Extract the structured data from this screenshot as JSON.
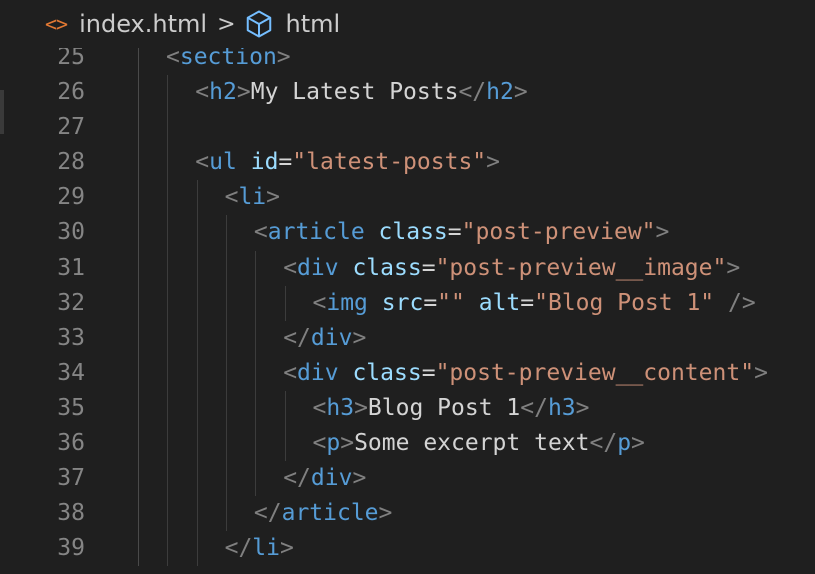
{
  "breadcrumb": {
    "file_icon": "<>",
    "file_name": "index.html",
    "separator": ">",
    "symbol_name": "html"
  },
  "colors": {
    "background": "#1f1f1f",
    "punctuation": "#808080",
    "tag": "#569cd6",
    "attribute": "#9cdcfe",
    "string": "#ce9178",
    "text": "#d4d4d4",
    "line_number": "#858585",
    "file_icon": "#e37933"
  },
  "lines": [
    {
      "number": "25",
      "indent": 0,
      "tokens": [
        [
          "punct",
          "<"
        ],
        [
          "tag",
          "section"
        ],
        [
          "punct",
          ">"
        ]
      ]
    },
    {
      "number": "26",
      "indent": 1,
      "tokens": [
        [
          "punct",
          "<"
        ],
        [
          "tag",
          "h2"
        ],
        [
          "punct",
          ">"
        ],
        [
          "text",
          "My Latest Posts"
        ],
        [
          "punct",
          "</"
        ],
        [
          "tag",
          "h2"
        ],
        [
          "punct",
          ">"
        ]
      ]
    },
    {
      "number": "27",
      "indent": 1,
      "tokens": []
    },
    {
      "number": "28",
      "indent": 1,
      "tokens": [
        [
          "punct",
          "<"
        ],
        [
          "tag",
          "ul"
        ],
        [
          "text",
          " "
        ],
        [
          "attr",
          "id"
        ],
        [
          "eq",
          "="
        ],
        [
          "str",
          "\"latest-posts\""
        ],
        [
          "punct",
          ">"
        ]
      ]
    },
    {
      "number": "29",
      "indent": 2,
      "tokens": [
        [
          "punct",
          "<"
        ],
        [
          "tag",
          "li"
        ],
        [
          "punct",
          ">"
        ]
      ]
    },
    {
      "number": "30",
      "indent": 3,
      "tokens": [
        [
          "punct",
          "<"
        ],
        [
          "tag",
          "article"
        ],
        [
          "text",
          " "
        ],
        [
          "attr",
          "class"
        ],
        [
          "eq",
          "="
        ],
        [
          "str",
          "\"post-preview\""
        ],
        [
          "punct",
          ">"
        ]
      ]
    },
    {
      "number": "31",
      "indent": 4,
      "tokens": [
        [
          "punct",
          "<"
        ],
        [
          "tag",
          "div"
        ],
        [
          "text",
          " "
        ],
        [
          "attr",
          "class"
        ],
        [
          "eq",
          "="
        ],
        [
          "str",
          "\"post-preview__image\""
        ],
        [
          "punct",
          ">"
        ]
      ]
    },
    {
      "number": "32",
      "indent": 5,
      "tokens": [
        [
          "punct",
          "<"
        ],
        [
          "tag",
          "img"
        ],
        [
          "text",
          " "
        ],
        [
          "attr",
          "src"
        ],
        [
          "eq",
          "="
        ],
        [
          "str",
          "\"\""
        ],
        [
          "text",
          " "
        ],
        [
          "attr",
          "alt"
        ],
        [
          "eq",
          "="
        ],
        [
          "str",
          "\"Blog Post 1\""
        ],
        [
          "text",
          " "
        ],
        [
          "punct",
          "/>"
        ]
      ]
    },
    {
      "number": "33",
      "indent": 4,
      "tokens": [
        [
          "punct",
          "</"
        ],
        [
          "tag",
          "div"
        ],
        [
          "punct",
          ">"
        ]
      ]
    },
    {
      "number": "34",
      "indent": 4,
      "tokens": [
        [
          "punct",
          "<"
        ],
        [
          "tag",
          "div"
        ],
        [
          "text",
          " "
        ],
        [
          "attr",
          "class"
        ],
        [
          "eq",
          "="
        ],
        [
          "str",
          "\"post-preview__content\""
        ],
        [
          "punct",
          ">"
        ]
      ]
    },
    {
      "number": "35",
      "indent": 5,
      "tokens": [
        [
          "punct",
          "<"
        ],
        [
          "tag",
          "h3"
        ],
        [
          "punct",
          ">"
        ],
        [
          "text",
          "Blog Post 1"
        ],
        [
          "punct",
          "</"
        ],
        [
          "tag",
          "h3"
        ],
        [
          "punct",
          ">"
        ]
      ]
    },
    {
      "number": "36",
      "indent": 5,
      "tokens": [
        [
          "punct",
          "<"
        ],
        [
          "tag",
          "p"
        ],
        [
          "punct",
          ">"
        ],
        [
          "text",
          "Some excerpt text"
        ],
        [
          "punct",
          "</"
        ],
        [
          "tag",
          "p"
        ],
        [
          "punct",
          ">"
        ]
      ]
    },
    {
      "number": "37",
      "indent": 4,
      "tokens": [
        [
          "punct",
          "</"
        ],
        [
          "tag",
          "div"
        ],
        [
          "punct",
          ">"
        ]
      ]
    },
    {
      "number": "38",
      "indent": 3,
      "tokens": [
        [
          "punct",
          "</"
        ],
        [
          "tag",
          "article"
        ],
        [
          "punct",
          ">"
        ]
      ]
    },
    {
      "number": "39",
      "indent": 2,
      "tokens": [
        [
          "punct",
          "</"
        ],
        [
          "tag",
          "li"
        ],
        [
          "punct",
          ">"
        ]
      ]
    }
  ]
}
